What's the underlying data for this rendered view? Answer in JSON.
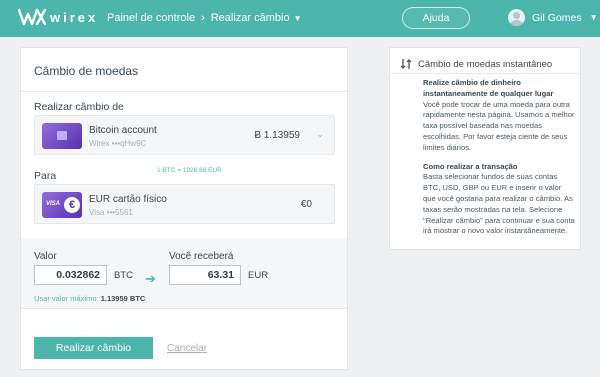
{
  "header": {
    "logo_text": "wirex",
    "breadcrumb": [
      "Painel de controle",
      "Realizar câmbio"
    ],
    "help_label": "Ajuda",
    "user_name": "Gil Gomes",
    "accent": "#4db6ac"
  },
  "exchange": {
    "title": "Câmbio de moedas",
    "from_label": "Realizar câmbio de",
    "from_account": {
      "name": "Bitcoin account",
      "sub": "Wirex •••qHw9C",
      "balance": "Ƀ 1.13959",
      "icon": "bitcoin-card-icon"
    },
    "rate": "1 BTC = 1926.68 EUR",
    "to_label": "Para",
    "to_account": {
      "name": "EUR cartão físico",
      "sub": "Visa •••5561",
      "balance": "€0",
      "icon": "visa-card-icon"
    },
    "amount_label": "Valor",
    "amount_value": "0.032862",
    "amount_currency": "BTC",
    "receive_label": "Você receberá",
    "receive_value": "63.31",
    "receive_currency": "EUR",
    "max_label": "Usar valor máximo:",
    "max_value": "1.13959 BTC",
    "submit_label": "Realizar câmbio",
    "cancel_label": "Cancelar"
  },
  "info": {
    "title": "Câmbio de moedas instantâneo",
    "heading1": "Realize câmbio de dinheiro instantaneamente de qualquer lugar",
    "text1": "Você pode trocar de uma moeda para outra rapidamente nesta página. Usamos a melhor taxa possível baseada nas moedas escolhidas. Por favor esteja ciente de seus limites diários.",
    "heading2": "Como realizar a transação",
    "text2": "Basta selecionar fundos de suas contas BTC, USD, GBP ou EUR e inserir o valor que você gostaria para realizar o câmbio. As taxas serão mostradas na tela. Selecione \"Realizar câmbio\" para continuar e sua conta irá mostrar o novo valor instantâneamente."
  }
}
